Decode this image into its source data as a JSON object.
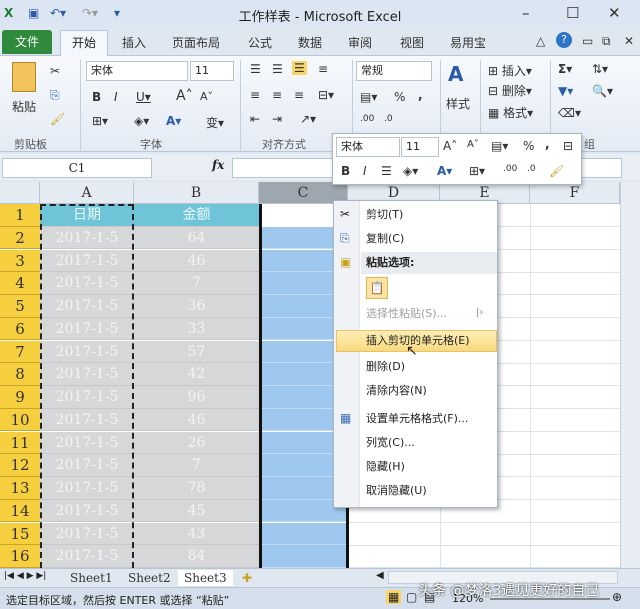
{
  "title": "工作样表 - Microsoft Excel",
  "tabs": [
    "文件",
    "开始",
    "插入",
    "页面布局",
    "公式",
    "数据",
    "审阅",
    "视图",
    "易用宝"
  ],
  "ribbon": {
    "paste": "粘贴",
    "font_name": "宋体",
    "font_size": "11",
    "number_format": "常规",
    "styles": "样式",
    "insert": "插入",
    "delete": "删除",
    "format": "格式",
    "groups": [
      "剪贴板",
      "字体",
      "对齐方式",
      "组"
    ]
  },
  "formula": {
    "name_box": "C1",
    "fx": "fx",
    "value": ""
  },
  "columns": [
    "A",
    "B",
    "C",
    "D",
    "E",
    "F"
  ],
  "rows": [
    [
      "1",
      "日期",
      "金额"
    ],
    [
      "2",
      "2017-1-5",
      "64"
    ],
    [
      "3",
      "2017-1-5",
      "46"
    ],
    [
      "4",
      "2017-1-5",
      "7"
    ],
    [
      "5",
      "2017-1-5",
      "36"
    ],
    [
      "6",
      "2017-1-5",
      "33"
    ],
    [
      "7",
      "2017-1-5",
      "57"
    ],
    [
      "8",
      "2017-1-5",
      "42"
    ],
    [
      "9",
      "2017-1-5",
      "96"
    ],
    [
      "10",
      "2017-1-5",
      "46"
    ],
    [
      "11",
      "2017-1-5",
      "26"
    ],
    [
      "12",
      "2017-1-5",
      "7"
    ],
    [
      "13",
      "2017-1-5",
      "78"
    ],
    [
      "14",
      "2017-1-5",
      "45"
    ],
    [
      "15",
      "2017-1-5",
      "43"
    ],
    [
      "16",
      "2017-1-5",
      "84"
    ]
  ],
  "mini_toolbar": {
    "font_name": "宋体",
    "font_size": "11"
  },
  "context_menu": {
    "cut": "剪切(T)",
    "copy": "复制(C)",
    "paste_options": "粘贴选项:",
    "paste_special": "选择性粘贴(S)...",
    "insert_cut": "插入剪切的单元格(E)",
    "delete": "删除(D)",
    "clear": "清除内容(N)",
    "format_cells": "设置单元格格式(F)...",
    "col_width": "列宽(C)...",
    "hide": "隐藏(H)",
    "unhide": "取消隐藏(U)"
  },
  "sheets": [
    "Sheet1",
    "Sheet2",
    "Sheet3"
  ],
  "status": {
    "message": "选定目标区域，然后按 ENTER 或选择 “粘贴”",
    "zoom": "120%"
  },
  "watermark": "头条 @梦洛3遇见更好的自己"
}
